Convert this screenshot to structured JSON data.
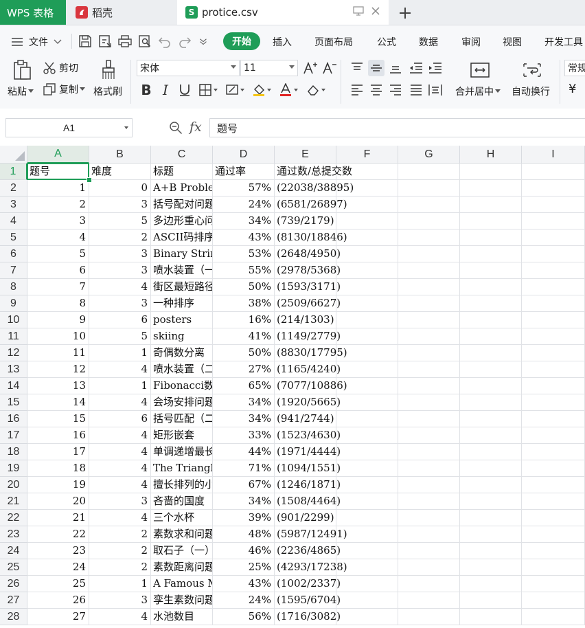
{
  "tabs": {
    "wps": "WPS 表格",
    "daoke": "稻壳",
    "file": "protice.csv"
  },
  "menu": {
    "file": "文件",
    "start": "开始",
    "items": [
      "插入",
      "页面布局",
      "公式",
      "数据",
      "审阅",
      "视图",
      "开发工具"
    ]
  },
  "ribbon": {
    "paste": "粘贴",
    "cut": "剪切",
    "copy": "复制",
    "format_painter": "格式刷",
    "font_name": "宋体",
    "font_size": "11",
    "merge_center": "合并居中",
    "wrap_text": "自动换行",
    "number_format": "常规",
    "currency_symbol": "¥"
  },
  "formula_bar": {
    "cell_ref": "A1",
    "fx": "fx",
    "content": "题号"
  },
  "grid": {
    "columns": [
      "A",
      "B",
      "C",
      "D",
      "E",
      "F",
      "G",
      "H",
      "I"
    ],
    "selected_cell": "A1",
    "header_row": {
      "a": "题号",
      "b": "难度",
      "c": "标题",
      "d": "通过率",
      "e": "通过数/总提交数"
    },
    "rows": [
      {
        "n": "1",
        "a": "题号",
        "b": "难度",
        "c": "标题",
        "d": "通过率",
        "e": "通过数/总提交数"
      },
      {
        "n": "2",
        "a": "1",
        "b": "0",
        "c": "A+B Problem",
        "d": "57%",
        "e": "(22038/38895)"
      },
      {
        "n": "3",
        "a": "2",
        "b": "3",
        "c": "括号配对问题",
        "d": "24%",
        "e": "(6581/26897)"
      },
      {
        "n": "4",
        "a": "3",
        "b": "5",
        "c": "多边形重心问题",
        "d": "34%",
        "e": "(739/2179)"
      },
      {
        "n": "5",
        "a": "4",
        "b": "2",
        "c": "ASCII码排序",
        "d": "43%",
        "e": "(8130/18846)"
      },
      {
        "n": "6",
        "a": "5",
        "b": "3",
        "c": "Binary String Matching",
        "d": "53%",
        "e": "(2648/4950)"
      },
      {
        "n": "7",
        "a": "6",
        "b": "3",
        "c": "喷水装置（一）",
        "d": "55%",
        "e": "(2978/5368)"
      },
      {
        "n": "8",
        "a": "7",
        "b": "4",
        "c": "街区最短路径问题",
        "d": "50%",
        "e": "(1593/3171)"
      },
      {
        "n": "9",
        "a": "8",
        "b": "3",
        "c": "一种排序",
        "d": "38%",
        "e": "(2509/6627)"
      },
      {
        "n": "10",
        "a": "9",
        "b": "6",
        "c": "posters",
        "d": "16%",
        "e": "(214/1303)"
      },
      {
        "n": "11",
        "a": "10",
        "b": "5",
        "c": "skiing",
        "d": "41%",
        "e": "(1149/2779)"
      },
      {
        "n": "12",
        "a": "11",
        "b": "1",
        "c": "奇偶数分离",
        "d": "50%",
        "e": "(8830/17795)"
      },
      {
        "n": "13",
        "a": "12",
        "b": "4",
        "c": "喷水装置（二）",
        "d": "27%",
        "e": "(1165/4240)"
      },
      {
        "n": "14",
        "a": "13",
        "b": "1",
        "c": "Fibonacci数",
        "d": "65%",
        "e": "(7077/10886)"
      },
      {
        "n": "15",
        "a": "14",
        "b": "4",
        "c": "会场安排问题",
        "d": "34%",
        "e": "(1920/5665)"
      },
      {
        "n": "16",
        "a": "15",
        "b": "6",
        "c": "括号匹配（二）",
        "d": "34%",
        "e": "(941/2744)"
      },
      {
        "n": "17",
        "a": "16",
        "b": "4",
        "c": "矩形嵌套",
        "d": "33%",
        "e": "(1523/4630)"
      },
      {
        "n": "18",
        "a": "17",
        "b": "4",
        "c": "单调递增最长子序列",
        "d": "44%",
        "e": "(1971/4444)"
      },
      {
        "n": "19",
        "a": "18",
        "b": "4",
        "c": "The Triangle",
        "d": "71%",
        "e": "(1094/1551)"
      },
      {
        "n": "20",
        "a": "19",
        "b": "4",
        "c": "擅长排列的小明",
        "d": "67%",
        "e": "(1246/1871)"
      },
      {
        "n": "21",
        "a": "20",
        "b": "3",
        "c": "吝啬的国度",
        "d": "34%",
        "e": "(1508/4464)"
      },
      {
        "n": "22",
        "a": "21",
        "b": "4",
        "c": "三个水杯",
        "d": "39%",
        "e": "(901/2299)"
      },
      {
        "n": "23",
        "a": "22",
        "b": "2",
        "c": "素数求和问题",
        "d": "48%",
        "e": "(5987/12491)"
      },
      {
        "n": "24",
        "a": "23",
        "b": "2",
        "c": "取石子（一）",
        "d": "46%",
        "e": "(2236/4865)"
      },
      {
        "n": "25",
        "a": "24",
        "b": "2",
        "c": "素数距离问题",
        "d": "25%",
        "e": "(4293/17238)"
      },
      {
        "n": "26",
        "a": "25",
        "b": "1",
        "c": "A Famous Music Composer",
        "d": "43%",
        "e": "(1002/2337)"
      },
      {
        "n": "27",
        "a": "26",
        "b": "3",
        "c": "孪生素数问题",
        "d": "24%",
        "e": "(1595/6704)"
      },
      {
        "n": "28",
        "a": "27",
        "b": "4",
        "c": "水池数目",
        "d": "56%",
        "e": "(1716/3082)"
      }
    ]
  },
  "colors": {
    "brand_green": "#1f9d58",
    "daoke_red": "#d9363e"
  }
}
